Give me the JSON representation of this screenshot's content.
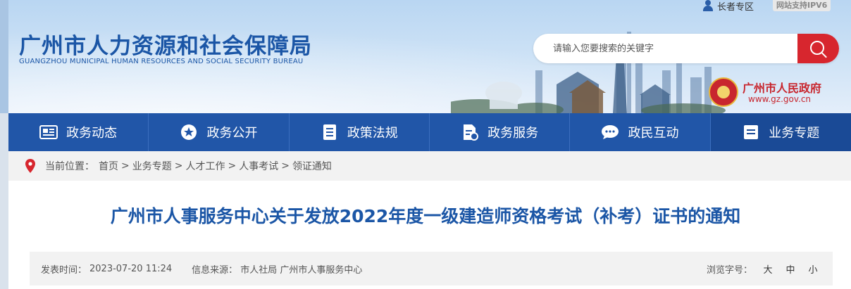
{
  "header": {
    "elder_link": "长者专区",
    "ipv6_badge": "网站支持IPV6",
    "logo_cn": "广州市人力资源和社会保障局",
    "logo_en": "GUANGZHOU MUNICIPAL HUMAN RESOURCES AND SOCIAL SECURITY BUREAU",
    "search": {
      "placeholder": "请输入您要搜索的关键字",
      "value": ""
    },
    "gov_logo": {
      "name": "广州市人民政府",
      "url": "www.gz.gov.cn"
    }
  },
  "nav": {
    "items": [
      {
        "label": "政务动态",
        "icon": "news-icon"
      },
      {
        "label": "政务公开",
        "icon": "star-icon"
      },
      {
        "label": "政策法规",
        "icon": "document-icon"
      },
      {
        "label": "政务服务",
        "icon": "service-icon"
      },
      {
        "label": "政民互动",
        "icon": "chat-icon"
      },
      {
        "label": "业务专题",
        "icon": "topic-icon",
        "active": true
      }
    ]
  },
  "breadcrumb": {
    "prefix": "当前位置：",
    "items": [
      "首页",
      "业务专题",
      "人才工作",
      "人事考试",
      "领证通知"
    ],
    "separator": ">"
  },
  "article": {
    "title": "广州市人事服务中心关于发放2022年度一级建造师资格考试（补考）证书的通知",
    "date_label": "发表时间：",
    "date": "2023-07-20 11:24",
    "source_label": "信息来源：",
    "source": "市人社局 广州市人事服务中心",
    "font_size_label": "浏览字号：",
    "font_sizes": [
      "大",
      "中",
      "小"
    ]
  },
  "colors": {
    "brand_blue": "#1b56a6",
    "nav_blue": "#2156a8",
    "search_red": "#d7262e"
  }
}
